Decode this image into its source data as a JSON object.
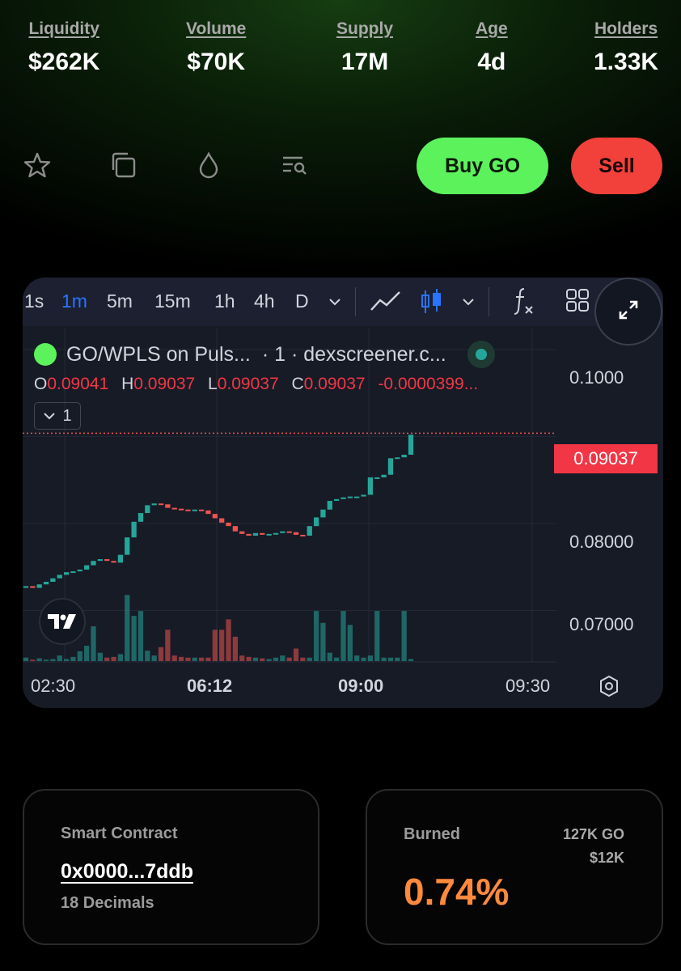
{
  "stats": [
    {
      "label": "Liquidity",
      "value": "$262K"
    },
    {
      "label": "Volume",
      "value": "$70K"
    },
    {
      "label": "Supply",
      "value": "17M"
    },
    {
      "label": "Age",
      "value": "4d"
    },
    {
      "label": "Holders",
      "value": "1.33K"
    }
  ],
  "actions": {
    "icons": [
      "star-icon",
      "copy-icon",
      "drop-icon",
      "search-list-icon"
    ],
    "buy_label": "Buy GO",
    "sell_label": "Sell"
  },
  "chart": {
    "timeframes": [
      "1s",
      "1m",
      "5m",
      "15m",
      "1h",
      "4h",
      "D"
    ],
    "active_timeframe": "1m",
    "legend": {
      "title": "GO/WPLS on Puls...",
      "interval": "· 1 · dexscreener.c...",
      "o_key": "O",
      "o_val": "0.09041",
      "h_key": "H",
      "h_val": "0.09037",
      "l_key": "L",
      "l_val": "0.09037",
      "c_key": "C",
      "c_val": "0.09037",
      "change": "-0.0000399...",
      "collapse_count": "1"
    },
    "price_axis": [
      "0.1000",
      "0.08000",
      "0.07000"
    ],
    "last_price": "0.09037",
    "time_axis": [
      "02:30",
      "06:12",
      "09:00",
      "09:30"
    ],
    "colors": {
      "up": "#26a69a",
      "down": "#ef5350",
      "accent": "#2a73ff"
    }
  },
  "chart_data": {
    "type": "candlestick",
    "pair": "GO/WPLS",
    "last_price": 0.09037,
    "close_series": [
      0.0728,
      0.0726,
      0.073,
      0.0733,
      0.0737,
      0.0741,
      0.0744,
      0.0745,
      0.0747,
      0.0752,
      0.0757,
      0.0759,
      0.0757,
      0.0755,
      0.0764,
      0.0784,
      0.0802,
      0.0812,
      0.0821,
      0.0823,
      0.0822,
      0.0818,
      0.0817,
      0.0816,
      0.0815,
      0.0816,
      0.0815,
      0.0811,
      0.0806,
      0.0801,
      0.0797,
      0.0791,
      0.0788,
      0.0786,
      0.0789,
      0.0787,
      0.0788,
      0.0789,
      0.0791,
      0.079,
      0.0787,
      0.0786,
      0.0797,
      0.0807,
      0.0816,
      0.0826,
      0.0828,
      0.083,
      0.0831,
      0.0831,
      0.0833,
      0.0853,
      0.0853,
      0.0856,
      0.0875,
      0.0876,
      0.0879,
      0.0902
    ],
    "volume_series": [
      0.05,
      0.02,
      0.04,
      0.02,
      0.03,
      0.08,
      0.03,
      0.06,
      0.14,
      0.22,
      0.5,
      0.12,
      0.05,
      0.06,
      0.1,
      0.95,
      0.65,
      0.72,
      0.15,
      0.08,
      0.2,
      0.45,
      0.08,
      0.06,
      0.05,
      0.05,
      0.05,
      0.05,
      0.45,
      0.45,
      0.6,
      0.35,
      0.08,
      0.06,
      0.05,
      0.04,
      0.03,
      0.05,
      0.08,
      0.05,
      0.18,
      0.05,
      0.05,
      0.72,
      0.55,
      0.12,
      0.05,
      0.72,
      0.52,
      0.08,
      0.05,
      0.08,
      0.72,
      0.05,
      0.05,
      0.05,
      0.72,
      0.03
    ]
  },
  "cards": {
    "contract_label": "Smart Contract",
    "contract_address": "0x0000...7ddb",
    "decimals": "18 Decimals",
    "burned_label": "Burned",
    "burned_tokens": "127K GO",
    "burned_usd": "$12K",
    "burned_pct": "0.74%"
  }
}
